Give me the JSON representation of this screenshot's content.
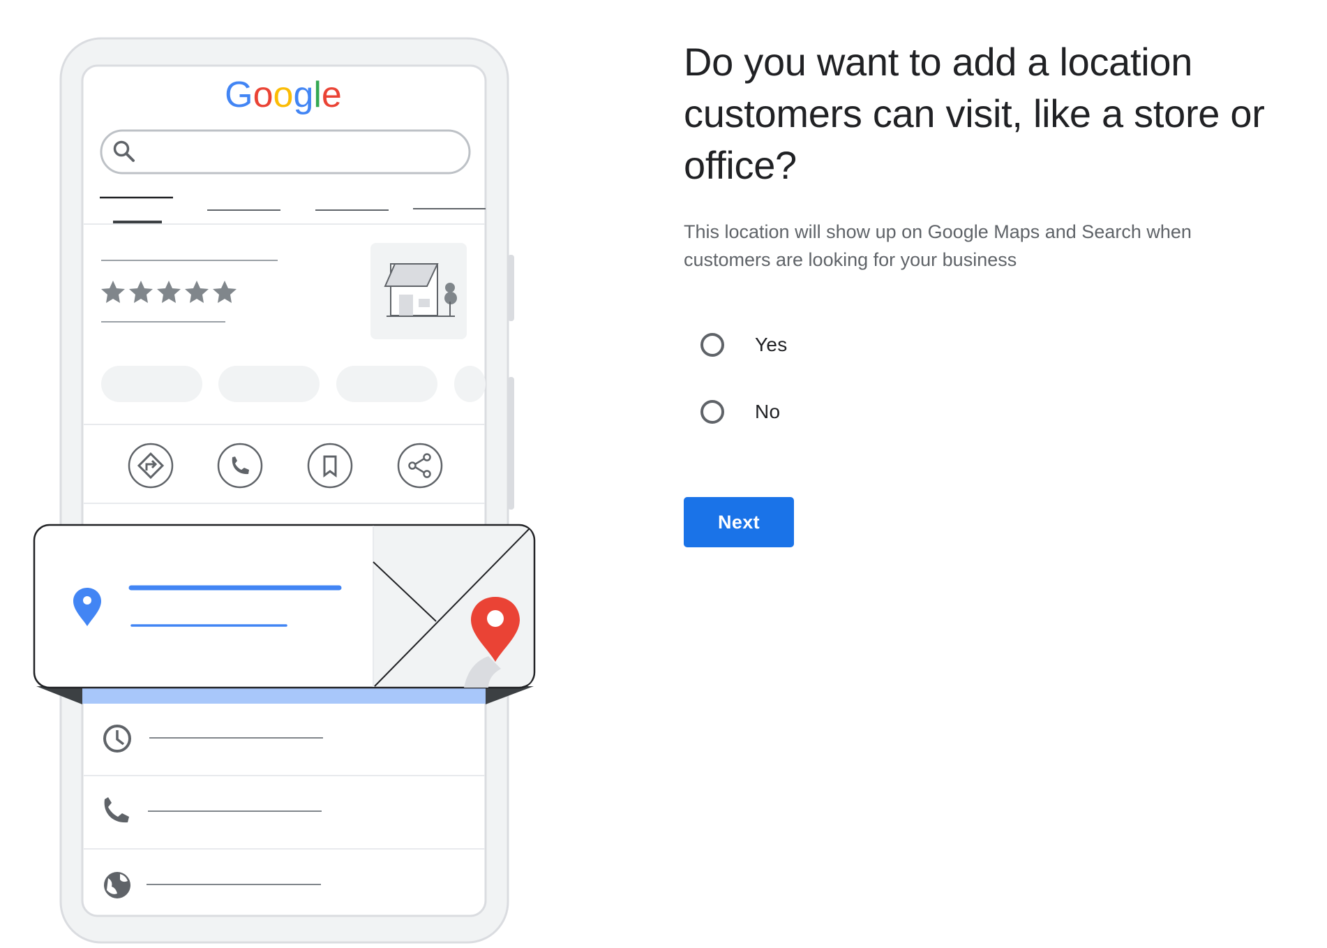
{
  "illustration": {
    "logo_text": "Google",
    "logo_colors": [
      "#4285F4",
      "#EA4335",
      "#FBBC05",
      "#4285F4",
      "#34A853",
      "#EA4335"
    ],
    "rating_stars": 5,
    "icons": [
      "search-icon",
      "directions-icon",
      "phone-icon",
      "bookmark-icon",
      "share-icon",
      "location-pin-icon",
      "map-pin-icon",
      "clock-icon",
      "phone-icon",
      "globe-icon"
    ]
  },
  "question": {
    "title": "Do you want to add a location customers can visit, like a store or office?",
    "description": "This location will show up on Google Maps and Search when customers are looking for your business"
  },
  "options": [
    {
      "label": "Yes",
      "selected": false
    },
    {
      "label": "No",
      "selected": false
    }
  ],
  "next_button": {
    "label": "Next"
  },
  "colors": {
    "accent": "#1a73e8",
    "text_primary": "#202124",
    "text_secondary": "#5f6368",
    "pin_blue": "#4285F4",
    "pin_red": "#EA4335",
    "highlight_band": "#a8c7fa"
  }
}
